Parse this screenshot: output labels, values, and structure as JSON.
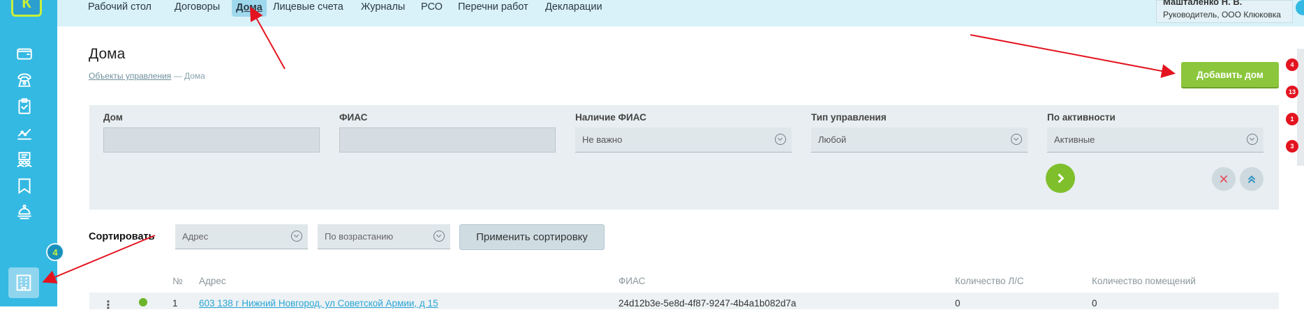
{
  "logo": {
    "letter": "К"
  },
  "sidebar": {
    "items": [
      {
        "icon": "wallet-icon"
      },
      {
        "icon": "phone-icon"
      },
      {
        "icon": "clipboard-check-icon"
      },
      {
        "icon": "chart-icon"
      },
      {
        "icon": "people-list-icon"
      },
      {
        "icon": "flag-icon"
      },
      {
        "icon": "service-bell-icon"
      },
      {
        "icon": "building-icon",
        "active": true
      }
    ],
    "badge": "4"
  },
  "nav": {
    "items": [
      "Рабочий стол",
      "Договоры",
      "Дома",
      "Лицевые счета",
      "Журналы",
      "РСО",
      "Перечни работ",
      "Декларации"
    ],
    "active": "Дома"
  },
  "user": {
    "name": "Машталенко Н. В.",
    "role": "Руководитель, ООО Клюковка"
  },
  "page": {
    "title": "Дома",
    "breadcrumb_link": "Объекты управления",
    "breadcrumb_sep": " — ",
    "breadcrumb_current": "Дома",
    "add_button": "Добавить дом"
  },
  "right_badges": [
    "4",
    "13",
    "1",
    "3"
  ],
  "filters": {
    "house_label": "Дом",
    "fias_label": "ФИАС",
    "fias_presence_label": "Наличие ФИАС",
    "fias_presence_value": "Не важно",
    "mgmt_type_label": "Тип управления",
    "mgmt_type_value": "Любой",
    "activity_label": "По активности",
    "activity_value": "Активные"
  },
  "sort": {
    "label": "Сортировать",
    "field": "Адрес",
    "order": "По возрастанию",
    "apply": "Применить сортировку"
  },
  "table": {
    "headers": {
      "num": "№",
      "address": "Адрес",
      "fias": "ФИАС",
      "accounts": "Количество Л/С",
      "rooms": "Количество помещений"
    },
    "rows": [
      {
        "num": "1",
        "address": "603 138 г Нижний Новгород, ул Советской Армии, д 15",
        "fias": "24d12b3e-5e8d-4f87-9247-4b4a1b082d7a",
        "accounts": "0",
        "rooms": "0"
      }
    ]
  },
  "colors": {
    "sidebar": "#34b9e3",
    "accent_green": "#8bc63c",
    "nav_bg": "#d9f1f9",
    "badge_red": "#e3141f",
    "annotation_arrow": "#e3141f"
  }
}
